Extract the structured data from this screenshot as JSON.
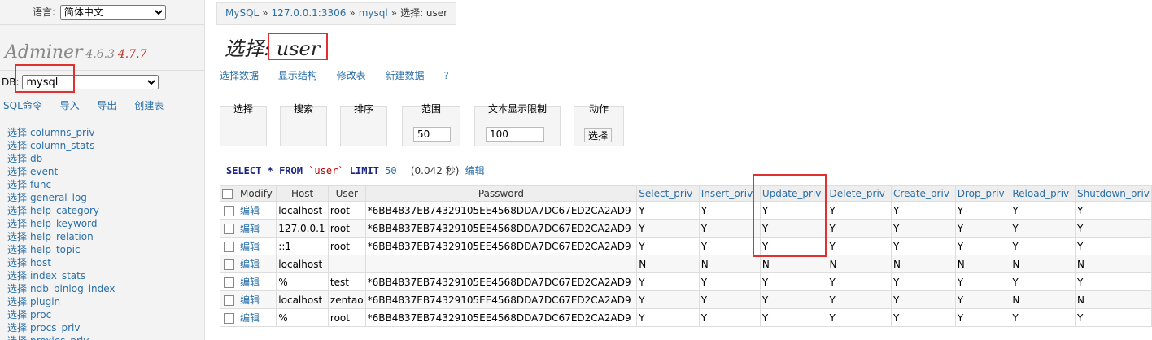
{
  "sidebar": {
    "language_label": "语言:",
    "language_value": "简体中文",
    "brand": {
      "name": "Adminer",
      "version": "4.6.3",
      "new_version": "4.7.7"
    },
    "db_label": "DB:",
    "db_value": "mysql",
    "links": [
      "SQL命令",
      "导入",
      "导出",
      "创建表"
    ],
    "select_word": "选择",
    "tables": [
      "columns_priv",
      "column_stats",
      "db",
      "event",
      "func",
      "general_log",
      "help_category",
      "help_keyword",
      "help_relation",
      "help_topic",
      "host",
      "index_stats",
      "ndb_binlog_index",
      "plugin",
      "proc",
      "procs_priv",
      "proxies_priv"
    ]
  },
  "breadcrumb": {
    "driver": "MySQL",
    "server": "127.0.0.1:3306",
    "db": "mysql",
    "current": "选择: user"
  },
  "page": {
    "title_prefix": "选择:",
    "title_table": "user"
  },
  "actions": [
    "选择数据",
    "显示结构",
    "修改表",
    "新建数据",
    "?"
  ],
  "form": {
    "select": "选择",
    "search": "搜索",
    "sort": "排序",
    "limit_label": "范围",
    "limit_value": "50",
    "text_length_label": "文本显示限制",
    "text_length_value": "100",
    "action_label": "动作",
    "action_button": "选择"
  },
  "query": {
    "select": "SELECT",
    "star": "*",
    "from": "FROM",
    "table": "`user`",
    "limit": "LIMIT",
    "limit_value": "50",
    "time": "(0.042 秒)",
    "edit": "编辑"
  },
  "grid": {
    "headers": [
      "Modify",
      "Host",
      "User",
      "Password",
      "Select_priv",
      "Insert_priv",
      "Update_priv",
      "Delete_priv",
      "Create_priv",
      "Drop_priv",
      "Reload_priv",
      "Shutdown_priv"
    ],
    "edit_label": "编辑",
    "rows": [
      [
        "localhost",
        "root",
        "*6BB4837EB74329105EE4568DDA7DC67ED2CA2AD9",
        "Y",
        "Y",
        "Y",
        "Y",
        "Y",
        "Y",
        "Y",
        "Y"
      ],
      [
        "127.0.0.1",
        "root",
        "*6BB4837EB74329105EE4568DDA7DC67ED2CA2AD9",
        "Y",
        "Y",
        "Y",
        "Y",
        "Y",
        "Y",
        "Y",
        "Y"
      ],
      [
        "::1",
        "root",
        "*6BB4837EB74329105EE4568DDA7DC67ED2CA2AD9",
        "Y",
        "Y",
        "Y",
        "Y",
        "Y",
        "Y",
        "Y",
        "Y"
      ],
      [
        "localhost",
        "",
        "",
        "N",
        "N",
        "N",
        "N",
        "N",
        "N",
        "N",
        "N"
      ],
      [
        "%",
        "test",
        "*6BB4837EB74329105EE4568DDA7DC67ED2CA2AD9",
        "Y",
        "Y",
        "Y",
        "Y",
        "Y",
        "Y",
        "Y",
        "Y"
      ],
      [
        "localhost",
        "zentao",
        "*6BB4837EB74329105EE4568DDA7DC67ED2CA2AD9",
        "Y",
        "Y",
        "Y",
        "Y",
        "Y",
        "Y",
        "N",
        "N"
      ],
      [
        "%",
        "root",
        "*6BB4837EB74329105EE4568DDA7DC67ED2CA2AD9",
        "Y",
        "Y",
        "Y",
        "Y",
        "Y",
        "Y",
        "Y",
        "Y"
      ]
    ]
  },
  "colors": {
    "link": "#2a6fa8",
    "highlight_box": "#e03030",
    "sql_keyword": "#1a237e",
    "sql_string": "#bb0000"
  }
}
